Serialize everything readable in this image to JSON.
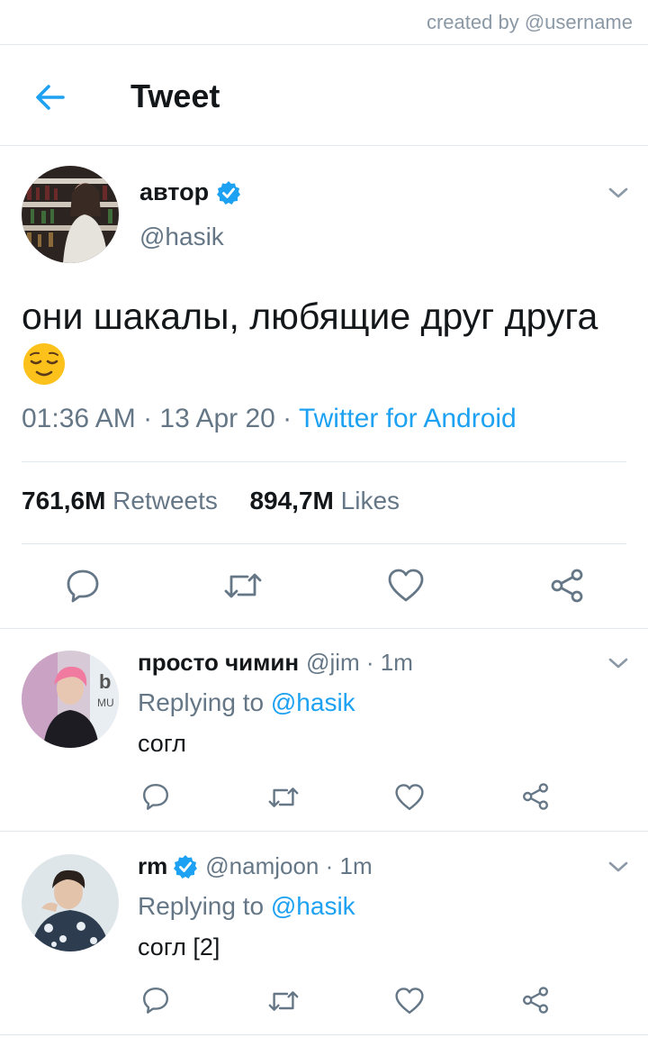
{
  "watermark": "created by @username",
  "header": {
    "title": "Tweet"
  },
  "tweet": {
    "author_name": "автор",
    "author_handle": "@hasik",
    "verified": true,
    "text": "они шакалы, любящие друг друга",
    "emoji": "relieved-face",
    "time": "01:36 AM · 13 Apr 20 · ",
    "source": "Twitter for Android",
    "retweets_count": "761,6M",
    "retweets_label": " Retweets",
    "likes_count": "894,7M",
    "likes_label": " Likes"
  },
  "replies": [
    {
      "name": "просто чимин",
      "handle": "@jim · 1m",
      "verified": false,
      "replying_prefix": "Replying to ",
      "replying_to": "@hasik",
      "text": "согл"
    },
    {
      "name": "rm",
      "handle": "@namjoon · 1m",
      "verified": true,
      "replying_prefix": "Replying to ",
      "replying_to": "@hasik",
      "text": "согл [2]"
    }
  ],
  "colors": {
    "accent": "#1da1f2",
    "muted": "#657786",
    "icon": "#657786",
    "divider": "#e1e8ed"
  }
}
